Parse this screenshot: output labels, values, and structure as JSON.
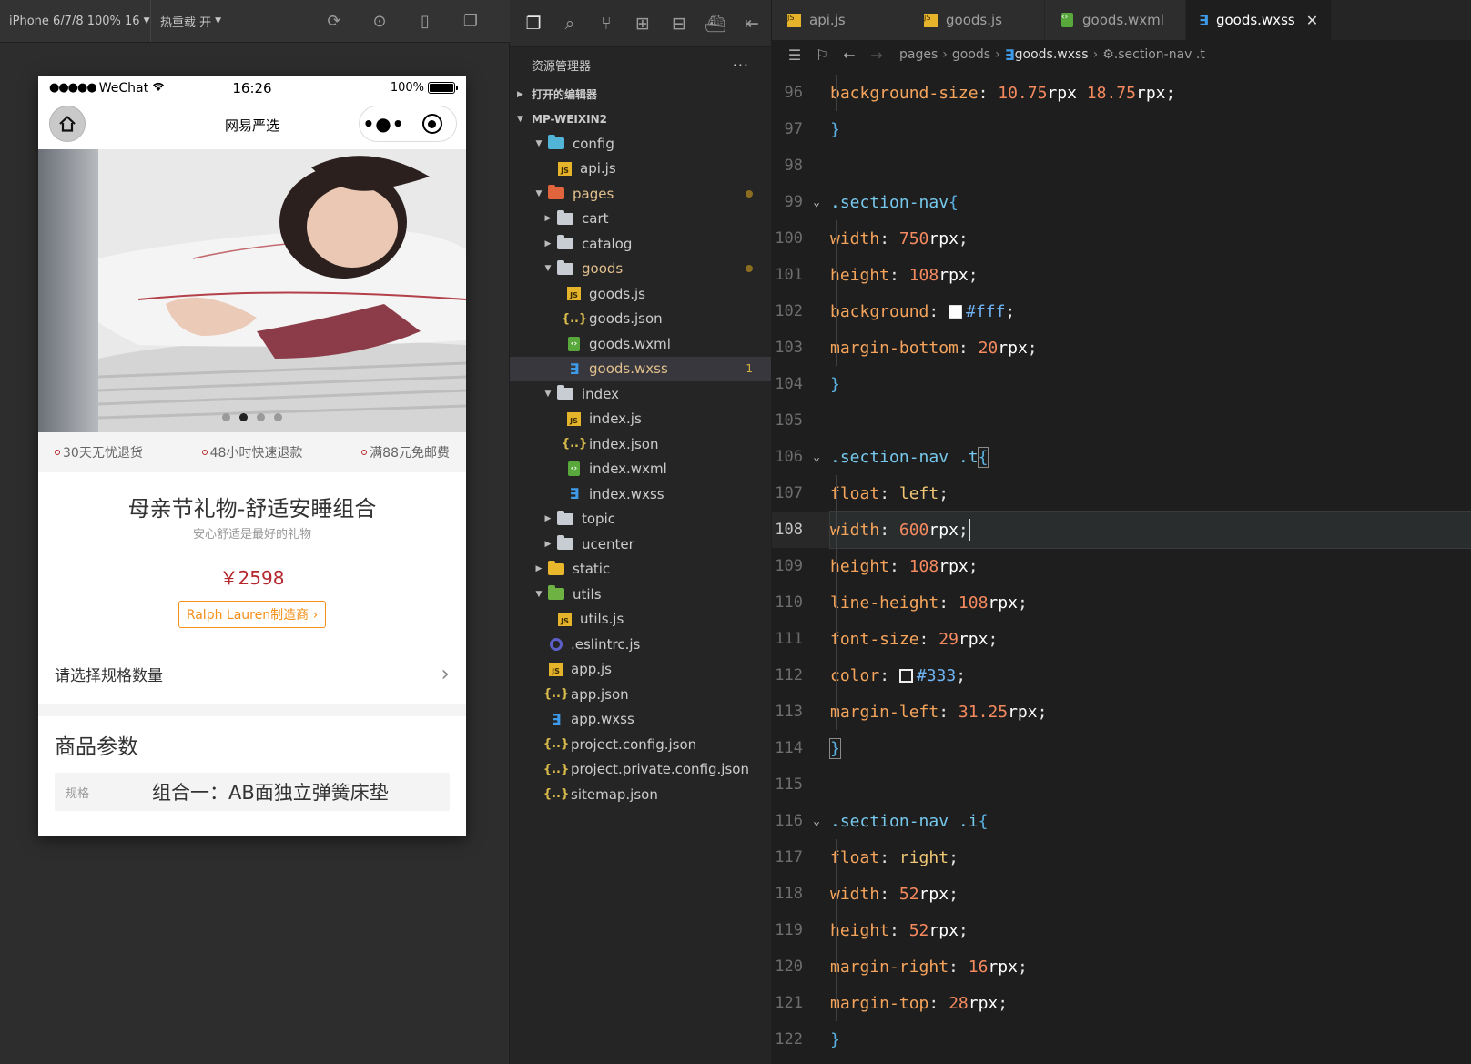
{
  "simulator": {
    "device_select": "iPhone 6/7/8 100% 16",
    "hot_reload": "热重载 开",
    "status_bar": {
      "carrier": "WeChat",
      "time": "16:26",
      "battery": "100%"
    },
    "nav_title": "网易严选",
    "banner_dots": 4,
    "banner_active_dot": 1,
    "services": [
      "30天无忧退货",
      "48小时快速退款",
      "满88元免邮费"
    ],
    "goods": {
      "name": "母亲节礼物-舒适安睡组合",
      "brief": "安心舒适是最好的礼物",
      "price": "￥2598",
      "brand": "Ralph Lauren制造商"
    },
    "spec_row": "请选择规格数量",
    "params_title": "商品参数",
    "params_key": "规格",
    "params_value": "组合一：AB面独立弹簧床垫"
  },
  "explorer": {
    "title": "资源管理器",
    "open_editors": "打开的编辑器",
    "project": "MP-WEIXIN2",
    "tree": [
      {
        "label": "config",
        "type": "folder-config",
        "depth": 1,
        "twisty": "open"
      },
      {
        "label": "api.js",
        "type": "js",
        "depth": 2
      },
      {
        "label": "pages",
        "type": "folder-pages",
        "depth": 1,
        "twisty": "open",
        "modified": true
      },
      {
        "label": "cart",
        "type": "folder",
        "depth": 2,
        "twisty": "closed"
      },
      {
        "label": "catalog",
        "type": "folder",
        "depth": 2,
        "twisty": "closed"
      },
      {
        "label": "goods",
        "type": "folder",
        "depth": 2,
        "twisty": "open",
        "modified": true
      },
      {
        "label": "goods.js",
        "type": "js",
        "depth": 3
      },
      {
        "label": "goods.json",
        "type": "json",
        "depth": 3
      },
      {
        "label": "goods.wxml",
        "type": "wxml",
        "depth": 3
      },
      {
        "label": "goods.wxss",
        "type": "wxss",
        "depth": 3,
        "selected": true,
        "modified": true,
        "badge": "1"
      },
      {
        "label": "index",
        "type": "folder",
        "depth": 2,
        "twisty": "open"
      },
      {
        "label": "index.js",
        "type": "js",
        "depth": 3
      },
      {
        "label": "index.json",
        "type": "json",
        "depth": 3
      },
      {
        "label": "index.wxml",
        "type": "wxml",
        "depth": 3
      },
      {
        "label": "index.wxss",
        "type": "wxss",
        "depth": 3
      },
      {
        "label": "topic",
        "type": "folder",
        "depth": 2,
        "twisty": "closed"
      },
      {
        "label": "ucenter",
        "type": "folder",
        "depth": 2,
        "twisty": "closed"
      },
      {
        "label": "static",
        "type": "folder-static",
        "depth": 1,
        "twisty": "closed"
      },
      {
        "label": "utils",
        "type": "folder-utils",
        "depth": 1,
        "twisty": "open"
      },
      {
        "label": "utils.js",
        "type": "js",
        "depth": 2
      },
      {
        "label": ".eslintrc.js",
        "type": "eslint",
        "depth": 1
      },
      {
        "label": "app.js",
        "type": "js",
        "depth": 1
      },
      {
        "label": "app.json",
        "type": "json",
        "depth": 1
      },
      {
        "label": "app.wxss",
        "type": "wxss",
        "depth": 1
      },
      {
        "label": "project.config.json",
        "type": "json",
        "depth": 1
      },
      {
        "label": "project.private.config.json",
        "type": "json",
        "depth": 1
      },
      {
        "label": "sitemap.json",
        "type": "json",
        "depth": 1
      }
    ]
  },
  "editor": {
    "tabs": [
      {
        "label": "api.js",
        "type": "js"
      },
      {
        "label": "goods.js",
        "type": "js"
      },
      {
        "label": "goods.wxml",
        "type": "wxml"
      },
      {
        "label": "goods.wxss",
        "type": "wxss",
        "active": true
      }
    ],
    "breadcrumb": [
      "pages",
      "goods",
      "goods.wxss",
      ".section-nav .t"
    ],
    "current_line": 108,
    "lines": [
      {
        "n": 96,
        "kind": "decl",
        "prop": "background-size",
        "value": [
          [
            "num",
            "10.75"
          ],
          [
            "unit",
            "rpx "
          ],
          [
            "num",
            "18.75"
          ],
          [
            "unit",
            "rpx"
          ]
        ]
      },
      {
        "n": 97,
        "kind": "close"
      },
      {
        "n": 98,
        "kind": "blank"
      },
      {
        "n": 99,
        "kind": "open",
        "selector": ".section-nav"
      },
      {
        "n": 100,
        "kind": "decl",
        "prop": "width",
        "value": [
          [
            "num",
            "750"
          ],
          [
            "unit",
            "rpx"
          ]
        ]
      },
      {
        "n": 101,
        "kind": "decl",
        "prop": "height",
        "value": [
          [
            "num",
            "108"
          ],
          [
            "unit",
            "rpx"
          ]
        ]
      },
      {
        "n": 102,
        "kind": "decl",
        "prop": "background",
        "value": [
          [
            "swatch",
            "#ffffff"
          ],
          [
            "hex",
            "#fff"
          ]
        ]
      },
      {
        "n": 103,
        "kind": "decl",
        "prop": "margin-bottom",
        "value": [
          [
            "num",
            "20"
          ],
          [
            "unit",
            "rpx"
          ]
        ]
      },
      {
        "n": 104,
        "kind": "close"
      },
      {
        "n": 105,
        "kind": "blank"
      },
      {
        "n": 106,
        "kind": "open",
        "selector": ".section-nav .t",
        "boxed": true
      },
      {
        "n": 107,
        "kind": "decl",
        "prop": "float",
        "value": [
          [
            "val",
            "left"
          ]
        ]
      },
      {
        "n": 108,
        "kind": "decl",
        "prop": "width",
        "value": [
          [
            "num",
            "600"
          ],
          [
            "unit",
            "rpx"
          ]
        ],
        "caret": true
      },
      {
        "n": 109,
        "kind": "decl",
        "prop": "height",
        "value": [
          [
            "num",
            "108"
          ],
          [
            "unit",
            "rpx"
          ]
        ]
      },
      {
        "n": 110,
        "kind": "decl",
        "prop": "line-height",
        "value": [
          [
            "num",
            "108"
          ],
          [
            "unit",
            "rpx"
          ]
        ]
      },
      {
        "n": 111,
        "kind": "decl",
        "prop": "font-size",
        "value": [
          [
            "num",
            "29"
          ],
          [
            "unit",
            "rpx"
          ]
        ]
      },
      {
        "n": 112,
        "kind": "decl",
        "prop": "color",
        "value": [
          [
            "swatch",
            "#333333"
          ],
          [
            "hex",
            "#333"
          ]
        ]
      },
      {
        "n": 113,
        "kind": "decl",
        "prop": "margin-left",
        "value": [
          [
            "num",
            "31.25"
          ],
          [
            "unit",
            "rpx"
          ]
        ]
      },
      {
        "n": 114,
        "kind": "close",
        "boxed": true
      },
      {
        "n": 115,
        "kind": "blank"
      },
      {
        "n": 116,
        "kind": "open",
        "selector": ".section-nav .i"
      },
      {
        "n": 117,
        "kind": "decl",
        "prop": "float",
        "value": [
          [
            "val",
            "right"
          ]
        ]
      },
      {
        "n": 118,
        "kind": "decl",
        "prop": "width",
        "value": [
          [
            "num",
            "52"
          ],
          [
            "unit",
            "rpx"
          ]
        ]
      },
      {
        "n": 119,
        "kind": "decl",
        "prop": "height",
        "value": [
          [
            "num",
            "52"
          ],
          [
            "unit",
            "rpx"
          ]
        ]
      },
      {
        "n": 120,
        "kind": "decl",
        "prop": "margin-right",
        "value": [
          [
            "num",
            "16"
          ],
          [
            "unit",
            "rpx"
          ]
        ]
      },
      {
        "n": 121,
        "kind": "decl",
        "prop": "margin-top",
        "value": [
          [
            "num",
            "28"
          ],
          [
            "unit",
            "rpx"
          ]
        ]
      },
      {
        "n": 122,
        "kind": "close"
      }
    ]
  }
}
